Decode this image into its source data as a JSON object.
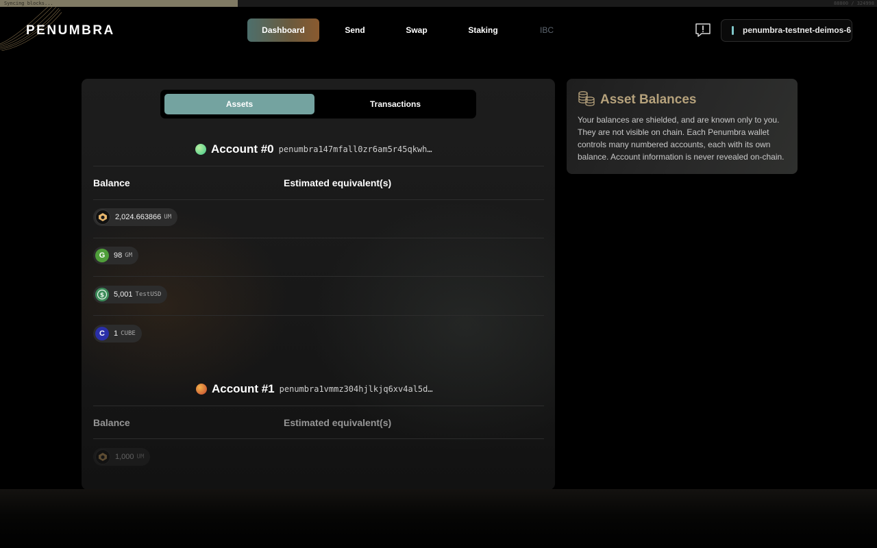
{
  "sync": {
    "status": "Syncing blocks...",
    "progress_text": "88800 / 324998",
    "progress_fraction": 0.273
  },
  "brand": {
    "name": "PENUMBRA"
  },
  "nav": {
    "items": [
      "Dashboard",
      "Send",
      "Swap",
      "Staking",
      "IBC"
    ],
    "active": "Dashboard",
    "disabled": [
      "IBC"
    ]
  },
  "chain": {
    "name": "penumbra-testnet-deimos-6"
  },
  "tabs": {
    "assets": "Assets",
    "transactions": "Transactions",
    "active": "Assets"
  },
  "table_headers": {
    "balance": "Balance",
    "equivalent": "Estimated equivalent(s)"
  },
  "accounts": [
    {
      "title": "Account #0",
      "address": "penumbra147mfall0zr6am5r45qkwh…",
      "assets": [
        {
          "amount": "2,024.663866",
          "symbol": "UM",
          "icon": "penumbra-um-icon"
        },
        {
          "amount": "98",
          "symbol": "GM",
          "icon": "G"
        },
        {
          "amount": "5,001",
          "symbol": "TestUSD",
          "icon": "dollar-coin-icon"
        },
        {
          "amount": "1",
          "symbol": "CUBE",
          "icon": "C"
        }
      ]
    },
    {
      "title": "Account #1",
      "address": "penumbra1vmmz304hjlkjq6xv4al5d…",
      "assets": [
        {
          "amount": "1,000",
          "symbol": "UM",
          "icon": "penumbra-um-icon"
        }
      ]
    }
  ],
  "info_card": {
    "title": "Asset Balances",
    "body": "Your balances are shielded, and are known only to you. They are not visible on chain. Each Penumbra wallet controls many numbered accounts, each with its own balance. Account information is never revealed on-chain."
  },
  "colors": {
    "accent_teal": "#74a3a0",
    "accent_copper": "#b6a27c",
    "background": "#000000"
  }
}
